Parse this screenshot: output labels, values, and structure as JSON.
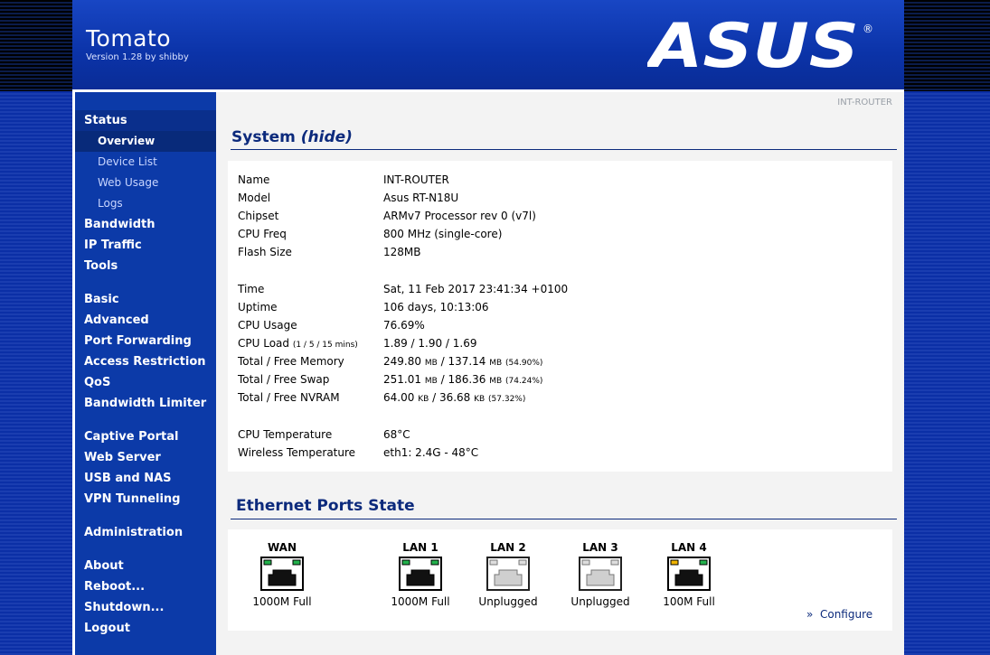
{
  "header": {
    "app_title": "Tomato",
    "version": "Version 1.28 by shibby",
    "brand": "ASUS",
    "brand_mark": "®"
  },
  "sidebar": {
    "status": "Status",
    "status_items": [
      "Overview",
      "Device List",
      "Web Usage",
      "Logs"
    ],
    "group1": [
      "Bandwidth",
      "IP Traffic",
      "Tools"
    ],
    "group2": [
      "Basic",
      "Advanced",
      "Port Forwarding",
      "Access Restriction",
      "QoS",
      "Bandwidth Limiter"
    ],
    "group3": [
      "Captive Portal",
      "Web Server",
      "USB and NAS",
      "VPN Tunneling"
    ],
    "group4": [
      "Administration"
    ],
    "group5": [
      "About",
      "Reboot...",
      "Shutdown...",
      "Logout"
    ]
  },
  "main": {
    "hostname": "INT-ROUTER",
    "system_title": "System",
    "system_hide": "(hide)",
    "system_rows": [
      {
        "label": "Name",
        "value": "INT-ROUTER"
      },
      {
        "label": "Model",
        "value": "Asus RT-N18U"
      },
      {
        "label": "Chipset",
        "value": "ARMv7 Processor rev 0 (v7l)"
      },
      {
        "label": "CPU Freq",
        "value": "800 MHz (single-core)"
      },
      {
        "label": "Flash Size",
        "value": "128MB"
      },
      {
        "label": "Time",
        "value": "Sat, 11 Feb 2017 23:41:34 +0100"
      },
      {
        "label": "Uptime",
        "value": "106 days, 10:13:06"
      },
      {
        "label": "CPU Usage",
        "value": "76.69%"
      },
      {
        "label": "CPU Load",
        "label_small": "(1 / 5 / 15 mins)",
        "value": "1.89 / 1.90 / 1.69"
      },
      {
        "label": "Total / Free Memory",
        "value": "249.80",
        "unit1": "MB",
        "mid": " / 137.14 ",
        "unit2": "MB",
        "pct": "(54.90%)"
      },
      {
        "label": "Total / Free Swap",
        "value": "251.01",
        "unit1": "MB",
        "mid": " / 186.36 ",
        "unit2": "MB",
        "pct": "(74.24%)"
      },
      {
        "label": "Total / Free NVRAM",
        "value": "64.00",
        "unit1": "KB",
        "mid": " / 36.68 ",
        "unit2": "KB",
        "pct": "(57.32%)"
      },
      {
        "label": "CPU Temperature",
        "value": "68°C"
      },
      {
        "label": "Wireless Temperature",
        "value": "eth1: 2.4G - 48°C"
      }
    ],
    "ethernet_title": "Ethernet Ports State",
    "ports": [
      {
        "name": "WAN",
        "status": "1000M Full",
        "state": "connected"
      },
      {
        "name": "LAN 1",
        "status": "1000M Full",
        "state": "connected"
      },
      {
        "name": "LAN 2",
        "status": "Unplugged",
        "state": "unplugged"
      },
      {
        "name": "LAN 3",
        "status": "Unplugged",
        "state": "unplugged"
      },
      {
        "name": "LAN 4",
        "status": "100M Full",
        "state": "connected-100"
      }
    ],
    "configure_prefix": "»",
    "configure_label": "Configure"
  },
  "colors": {
    "brand_blue": "#0b33a8",
    "title_blue": "#0c2a7c",
    "led_green": "#22b14c",
    "led_amber": "#f0b400"
  }
}
